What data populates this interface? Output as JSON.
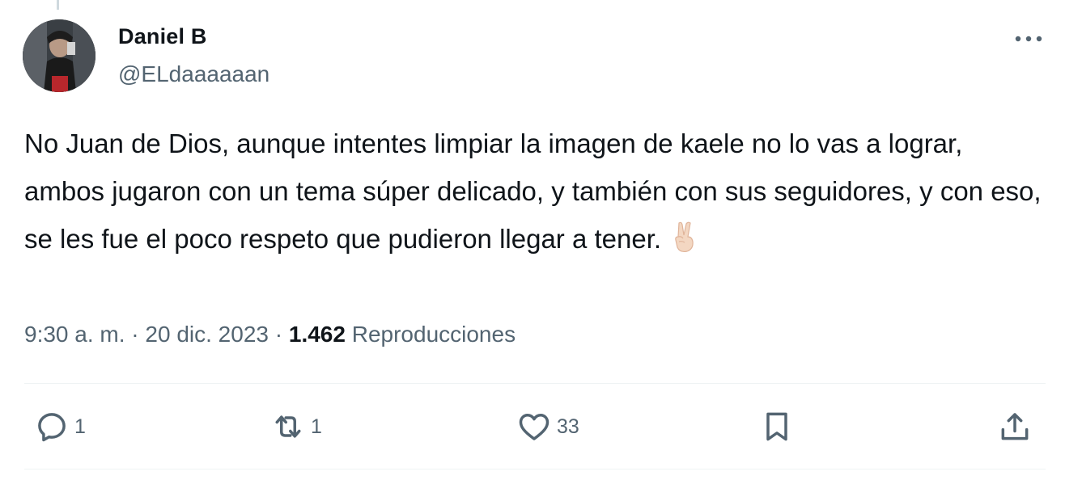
{
  "author": {
    "name": "Daniel B",
    "handle": "@ELdaaaaaan"
  },
  "tweet": {
    "text": "No Juan de Dios, aunque intentes limpiar la imagen de kaele no lo vas a lograr, ambos jugaron con un tema súper delicado, y también con sus seguidores, y con eso, se les fue el poco respeto que pudieron llegar a tener.",
    "emoji": "victory-hand-emoji"
  },
  "meta": {
    "time": "9:30 a. m.",
    "separator": "·",
    "date": "20 dic. 2023",
    "views_count": "1.462",
    "views_label": "Reproducciones"
  },
  "actions": {
    "replies": "1",
    "retweets": "1",
    "likes": "33"
  },
  "icons": {
    "more": "more-horizontal-icon",
    "reply": "reply-icon",
    "retweet": "retweet-icon",
    "like": "heart-icon",
    "bookmark": "bookmark-icon",
    "share": "share-icon"
  },
  "colors": {
    "text": "#0f1419",
    "secondary": "#536471",
    "divider": "#eff3f4"
  }
}
